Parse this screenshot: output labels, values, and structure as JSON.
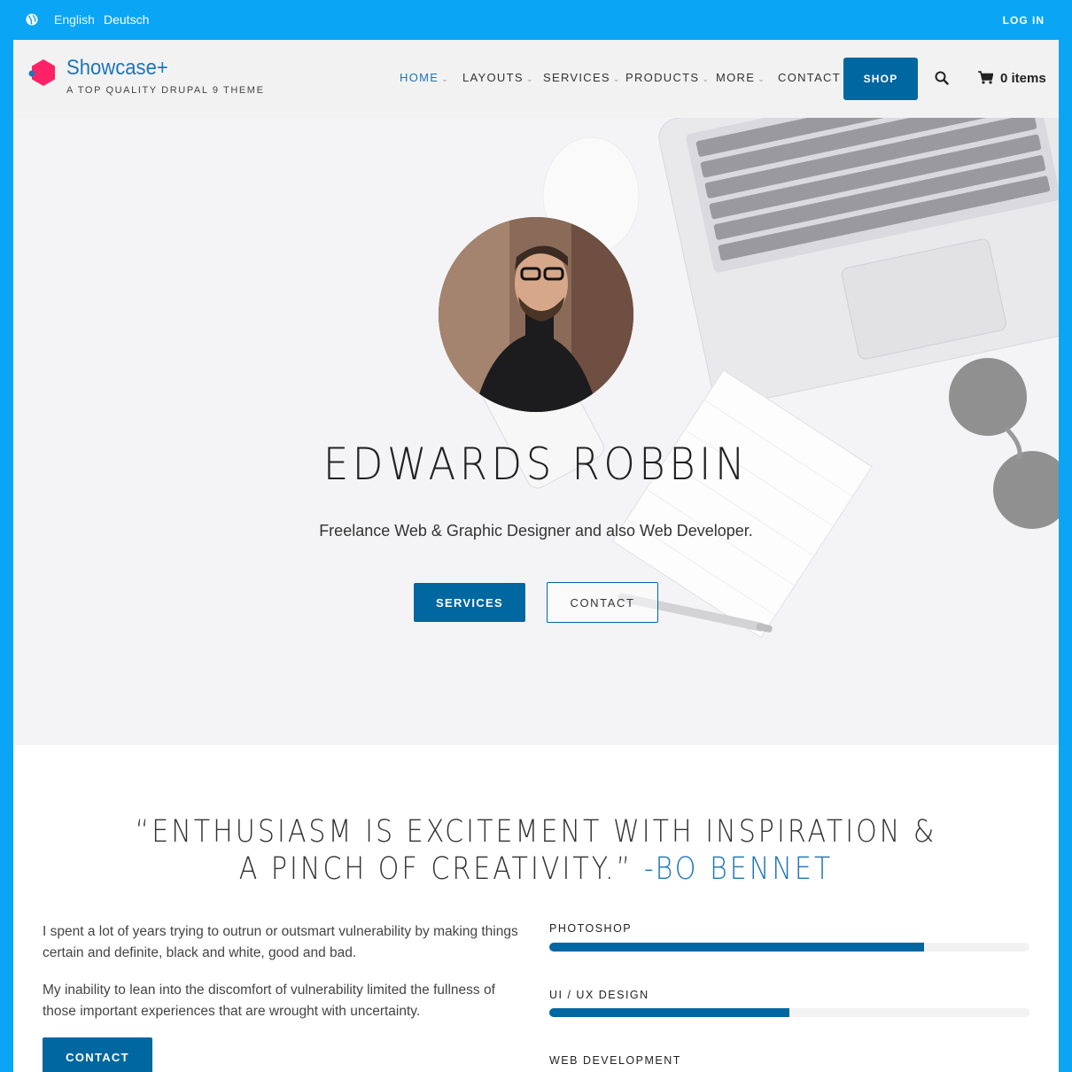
{
  "topbar": {
    "languages": [
      "English",
      "Deutsch"
    ],
    "login": "LOG IN"
  },
  "header": {
    "site_name": "Showcase+",
    "slogan": "A TOP QUALITY DRUPAL 9 THEME",
    "nav": [
      "HOME",
      "LAYOUTS",
      "SERVICES",
      "PRODUCTS",
      "MORE",
      "CONTACT"
    ],
    "shop": "SHOP",
    "cart": "0 items"
  },
  "hero": {
    "name": "EDWARDS ROBBIN",
    "tagline": "Freelance Web & Graphic Designer and also Web Developer.",
    "primary_button": "SERVICES",
    "secondary_button": "CONTACT"
  },
  "quote": {
    "line1": "“ENTHUSIASM IS EXCITEMENT WITH INSPIRATION &",
    "line2": "A PINCH OF CREATIVITY.”",
    "author": "-BO BENNET"
  },
  "about": {
    "p1": "I spent a lot of years trying to outrun or outsmart vulnerability by making things certain and definite, black and white, good and bad.",
    "p2": "My inability to lean into the discomfort of vulnerability limited the fullness of those important experiences that are wrought with uncertainty.",
    "button": "CONTACT"
  },
  "skills": [
    {
      "name": "PHOTOSHOP",
      "level": 0.78
    },
    {
      "name": "UI / UX DESIGN",
      "level": 0.5
    },
    {
      "name": "WEB DEVELOPMENT"
    }
  ],
  "colors": {
    "frame": "#0ba5f5",
    "primary": "#0067a0",
    "link": "#1f75b9",
    "logo": "#ff2266"
  }
}
